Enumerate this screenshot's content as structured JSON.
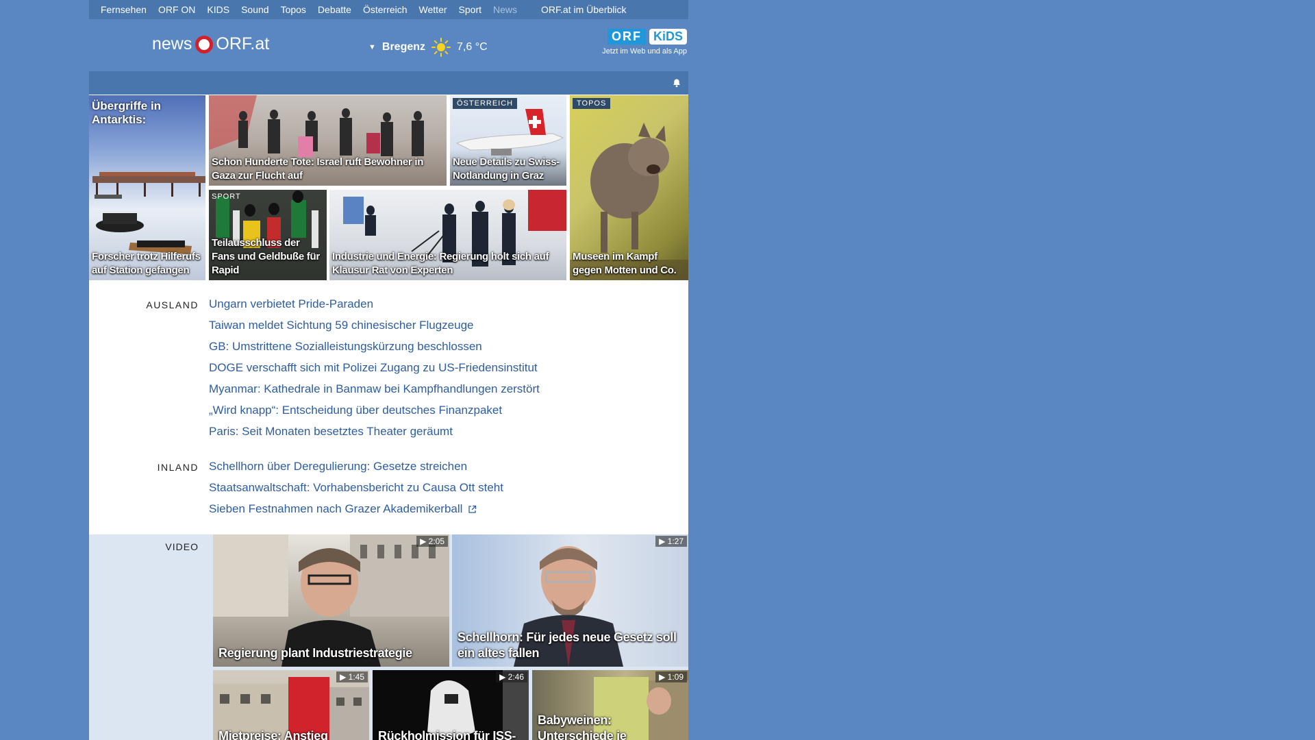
{
  "nav": {
    "items": [
      "Fernsehen",
      "ORF ON",
      "KIDS",
      "Sound",
      "Topos",
      "Debatte",
      "Österreich",
      "Wetter",
      "Sport",
      "News"
    ],
    "overview": "ORF.at im Überblick"
  },
  "header": {
    "logo_news": "news",
    "logo_orf": "ORF.at",
    "weather_city": "Bregenz",
    "weather_temp": "7,6 °C",
    "weather_icon": "sun-icon",
    "kids_orf": "ORF",
    "kids_label": "KiDS",
    "kids_sub": "Jetzt im Web und als App"
  },
  "teasers": {
    "antarktis_title": "Übergriffe in Antarktis:",
    "antarktis": "Forscher trotz Hilferufs auf Station gefangen",
    "gaza": "Schon Hunderte Tote: Israel ruft Bewohner in Gaza zur Flucht auf",
    "swiss_tag": "ÖSTERREICH",
    "swiss": "Neue Details zu Swiss-Notlandung in Graz",
    "topos_tag": "TOPOS",
    "topos": "Museen im Kampf gegen Motten und Co.",
    "sport_tag": "SPORT",
    "sport": "Teilausschluss der Fans und Geldbuße für Rapid",
    "industrie": "Industrie und Energie: Regierung holt sich auf Klausur Rat von Experten"
  },
  "ausland": {
    "label": "AUSLAND",
    "items": [
      "Ungarn verbietet Pride-Paraden",
      "Taiwan meldet Sichtung 59 chinesischer Flugzeuge",
      "GB: Umstrittene Sozialleistungskürzung beschlossen",
      "DOGE verschafft sich mit Polizei Zugang zu US-Friedensinstitut",
      "Myanmar: Kathedrale in Banmaw bei Kampfhandlungen zerstört",
      "„Wird knapp“: Entscheidung über deutsches Finanzpaket",
      "Paris: Seit Monaten besetztes Theater geräumt"
    ]
  },
  "inland": {
    "label": "INLAND",
    "items": [
      "Schellhorn über Deregulierung: Gesetze streichen",
      "Staatsanwaltschaft: Vorhabensbericht zu Causa Ott steht",
      "Sieben Festnahmen nach Grazer Akademikerball"
    ]
  },
  "video": {
    "label": "VIDEO",
    "items": [
      {
        "title": "Regierung plant Industriestrategie",
        "duration": "2:05"
      },
      {
        "title": "Schellhorn: Für jedes neue Gesetz soll ein altes fallen",
        "duration": "1:27"
      },
      {
        "title": "Mietpreise: Anstieg",
        "duration": "1:45"
      },
      {
        "title": "Rückholmission für ISS-",
        "duration": "2:46"
      },
      {
        "title": "Babyweinen: Unterschiede je",
        "duration": "1:09"
      }
    ]
  },
  "colors": {
    "background": "#5a87c2",
    "nav": "#4a76ae",
    "link": "#2e5d9f",
    "orf_red": "#d3212c"
  }
}
